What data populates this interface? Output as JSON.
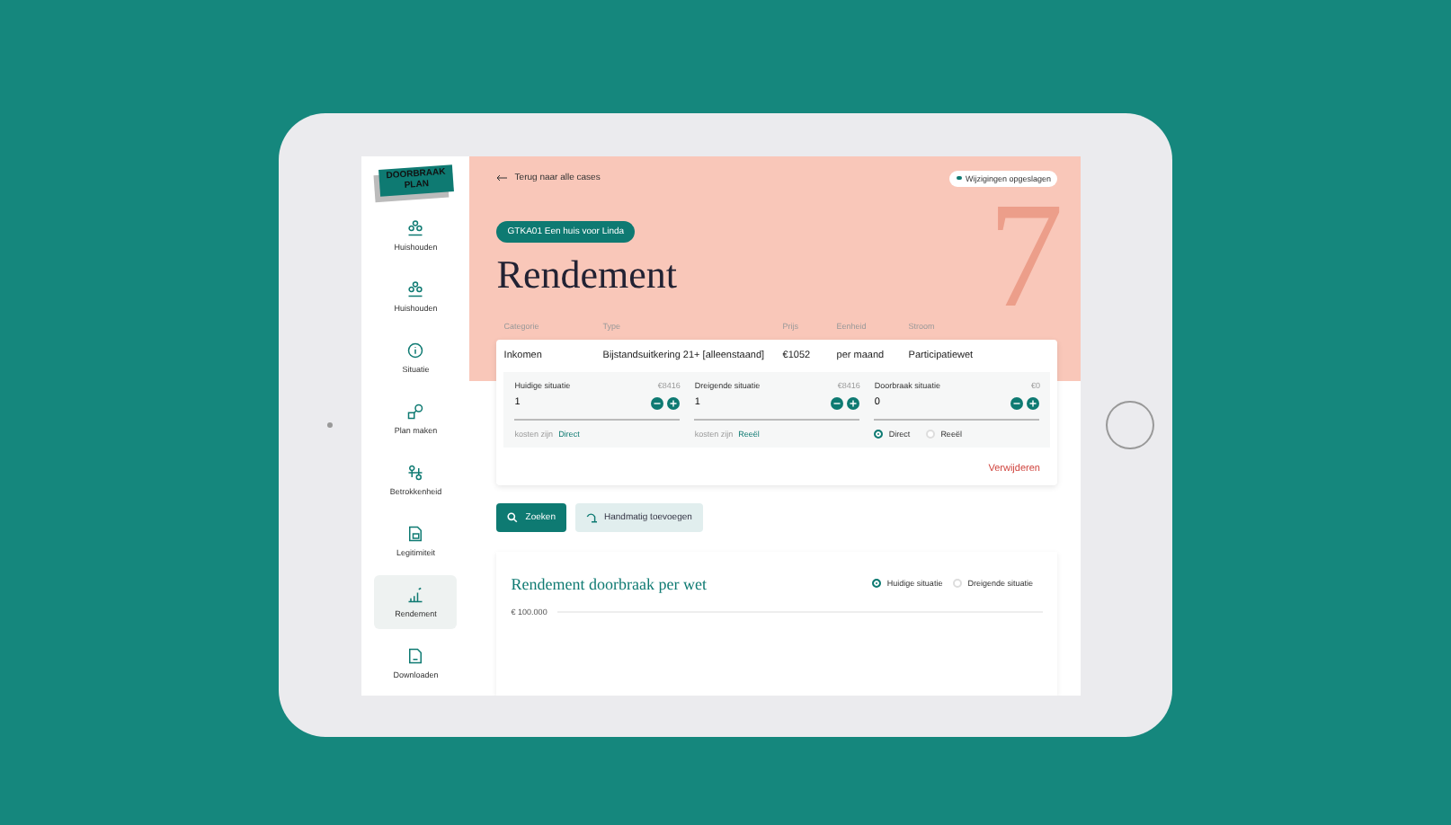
{
  "sidebar": {
    "logo_lines": [
      "DOORBRAAK",
      "PLAN"
    ],
    "items": [
      {
        "kind": "people",
        "label": "Huishouden",
        "selected": false
      },
      {
        "kind": "people",
        "label": "Huishouden",
        "selected": false
      },
      {
        "kind": "info",
        "label": "Situatie",
        "selected": false
      },
      {
        "kind": "plan",
        "label": "Plan maken",
        "selected": false
      },
      {
        "kind": "network",
        "label": "Betrokkenheid",
        "selected": false
      },
      {
        "kind": "document",
        "label": "Legitimiteit",
        "selected": false
      },
      {
        "kind": "chart",
        "label": "Rendement",
        "selected": true
      },
      {
        "kind": "download",
        "label": "Downloaden",
        "selected": false
      }
    ]
  },
  "header": {
    "back_link": "Terug naar alle cases",
    "status": "Wijzigingen opgeslagen",
    "case_tag": "GTKA01 Een huis voor Linda",
    "title": "Rendement",
    "step_number": "7"
  },
  "table": {
    "columns": [
      "Categorie",
      "Type",
      "Prijs",
      "Eenheid",
      "Stroom"
    ],
    "rows": [
      {
        "cells": [
          "Inkomen",
          "Bijstandsuitkering 21+ [alleenstaand]",
          "€1052",
          "per maand",
          "Participatiewet"
        ],
        "situations": [
          {
            "kind": "cost",
            "label": "Huidige situatie",
            "amount": "€8416",
            "value": "1",
            "cost_label": "kosten zijn",
            "cost_type": "Direct"
          },
          {
            "kind": "cost",
            "label": "Dreigende situatie",
            "amount": "€8416",
            "value": "1",
            "cost_label": "kosten zijn",
            "cost_type": "Reeël"
          },
          {
            "kind": "choice",
            "label": "Doorbraak situatie",
            "amount": "€0",
            "value": "0",
            "options": [
              {
                "label": "Direct",
                "selected": true
              },
              {
                "label": "Reeël",
                "selected": false
              }
            ]
          }
        ],
        "delete_link": "Verwijderen"
      }
    ]
  },
  "actions": [
    {
      "kind": "primary",
      "label": "Zoeken"
    },
    {
      "kind": "secondary",
      "label": "Handmatig toevoegen"
    }
  ],
  "chart_card": {
    "title": "Rendement doorbraak per wet",
    "options": [
      {
        "label": "Huidige situatie",
        "selected": true
      },
      {
        "label": "Dreigende situatie",
        "selected": false
      }
    ],
    "y_tick_labels": [
      "€ 100.000"
    ]
  }
}
